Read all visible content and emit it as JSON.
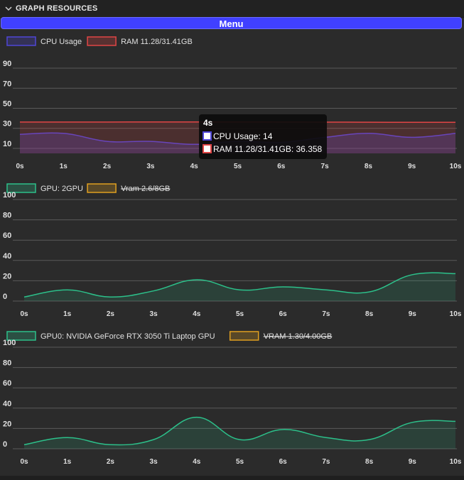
{
  "panel": {
    "title": "GRAPH RESOURCES"
  },
  "menu": {
    "label": "Menu"
  },
  "colors": {
    "cpu": "#4f46d6",
    "ram": "#e04545",
    "gpu": "#2cc08a",
    "vram": "#e0a020",
    "grid": "#5a5a5a",
    "text": "#e0e0e0"
  },
  "charts": [
    {
      "type": "line",
      "legend": [
        {
          "label": "CPU Usage",
          "color": "#4f46d6",
          "hidden": false
        },
        {
          "label": "RAM 11.28/31.41GB",
          "color": "#e04545",
          "hidden": false
        }
      ],
      "categories": [
        "0s",
        "1s",
        "2s",
        "3s",
        "4s",
        "5s",
        "6s",
        "7s",
        "8s",
        "9s",
        "10s"
      ],
      "ylim": [
        5,
        95
      ],
      "yticks": [
        10,
        30,
        50,
        70,
        90
      ],
      "series": [
        {
          "name": "CPU Usage",
          "color": "#4f46d6",
          "values": [
            24,
            25,
            17,
            17,
            14,
            17,
            16,
            21,
            25,
            21,
            25
          ]
        },
        {
          "name": "RAM 11.28/31.41GB",
          "color": "#e04545",
          "values": [
            36.3,
            36.3,
            36.3,
            36.4,
            36.358,
            36.4,
            36.3,
            36.2,
            36.1,
            36.0,
            36.0
          ]
        }
      ],
      "tooltip": {
        "title": "4s",
        "lines": [
          "CPU Usage: 14",
          "RAM 11.28/31.41GB: 36.358"
        ],
        "colors": [
          "#4f46d6",
          "#e04545"
        ]
      }
    },
    {
      "type": "area",
      "legend": [
        {
          "label": "GPU: 2GPU",
          "color": "#2cc08a",
          "hidden": false
        },
        {
          "label": "Vram 2.6/8GB",
          "color": "#e0a020",
          "hidden": true
        }
      ],
      "categories": [
        "0s",
        "1s",
        "2s",
        "3s",
        "4s",
        "5s",
        "6s",
        "7s",
        "8s",
        "9s",
        "10s"
      ],
      "ylim": [
        0,
        100
      ],
      "yticks": [
        0,
        20,
        40,
        60,
        80,
        100
      ],
      "series": [
        {
          "name": "GPU: 2GPU",
          "color": "#2cc08a",
          "values": [
            4,
            11,
            4,
            10,
            21,
            11,
            14,
            11,
            9,
            26,
            27
          ]
        }
      ]
    },
    {
      "type": "area",
      "legend": [
        {
          "label": "GPU0: NVIDIA GeForce RTX 3050 Ti Laptop GPU",
          "color": "#2cc08a",
          "hidden": false
        },
        {
          "label": "VRAM 1.30/4.00GB",
          "color": "#e0a020",
          "hidden": true
        }
      ],
      "categories": [
        "0s",
        "1s",
        "2s",
        "3s",
        "4s",
        "5s",
        "6s",
        "7s",
        "8s",
        "9s",
        "10s"
      ],
      "ylim": [
        0,
        100
      ],
      "yticks": [
        0,
        20,
        40,
        60,
        80,
        100
      ],
      "series": [
        {
          "name": "GPU0: NVIDIA GeForce RTX 3050 Ti Laptop GPU",
          "color": "#2cc08a",
          "values": [
            4,
            11,
            4,
            9,
            31,
            9,
            19,
            11,
            9,
            26,
            27
          ]
        }
      ]
    }
  ]
}
